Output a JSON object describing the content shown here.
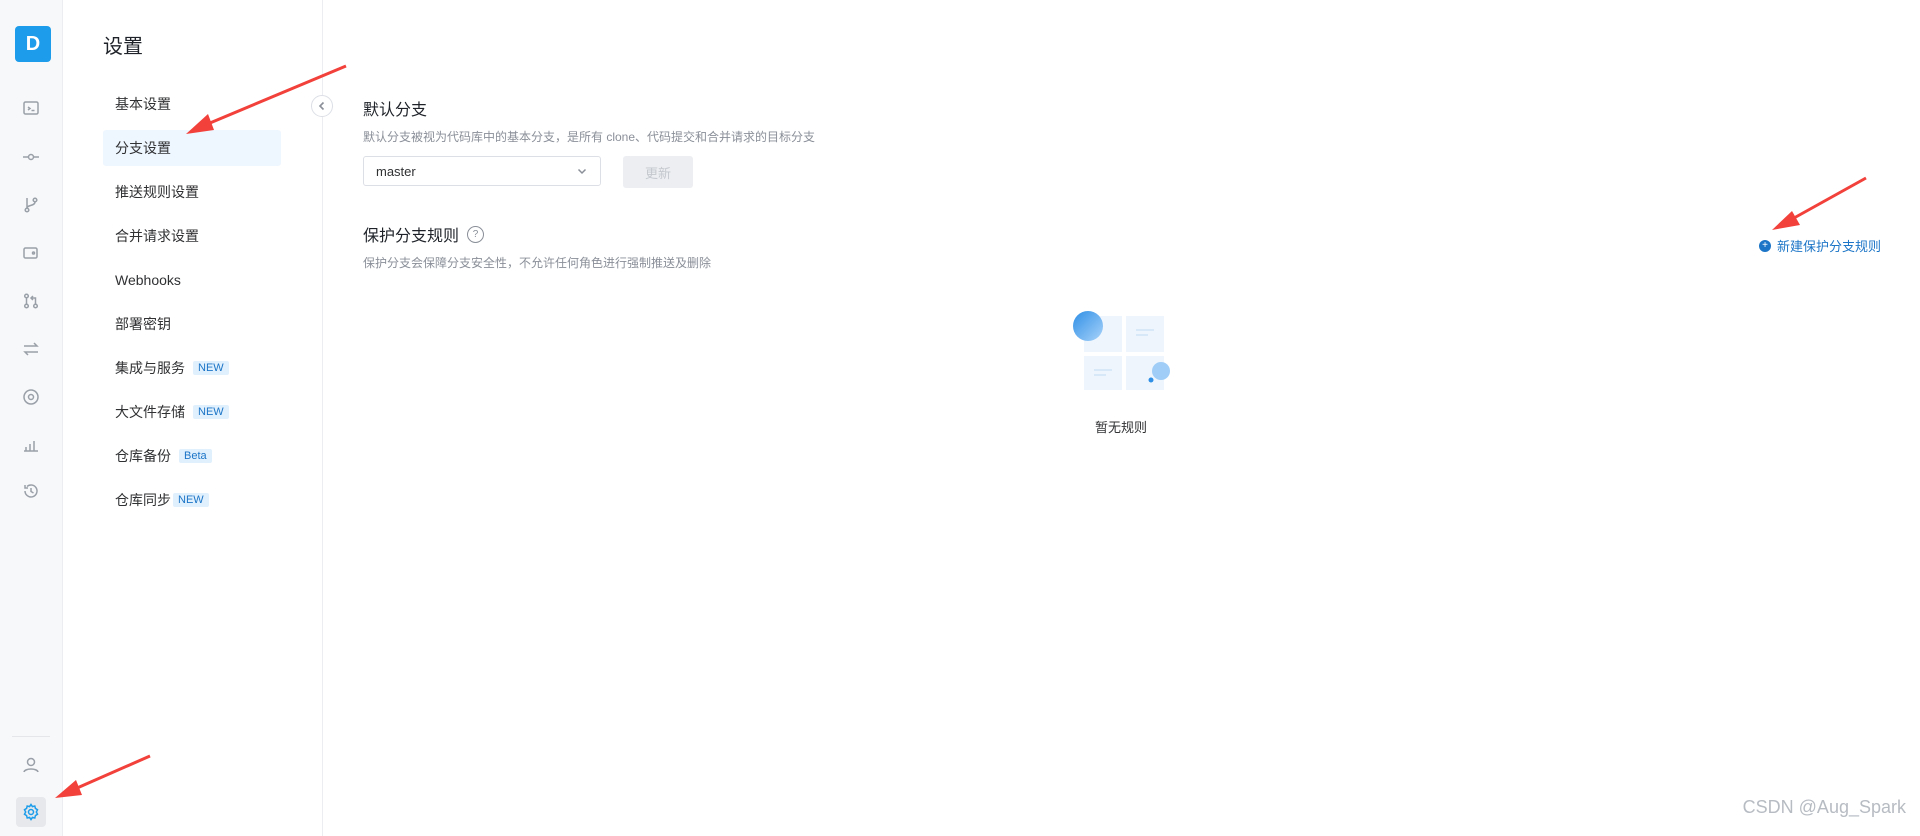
{
  "rail": {
    "logo_letter": "D",
    "icons": [
      "code-icon",
      "commit-icon",
      "branch-icon",
      "tag-icon",
      "merge-request-icon",
      "compare-icon",
      "eye-icon",
      "stats-icon",
      "history-icon",
      "user-icon",
      "gear-icon"
    ],
    "accent": "#1c9cea"
  },
  "page": {
    "title": "设置"
  },
  "subnav": {
    "items": [
      {
        "label": "基本设置"
      },
      {
        "label": "分支设置"
      },
      {
        "label": "推送规则设置"
      },
      {
        "label": "合并请求设置"
      },
      {
        "label": "Webhooks"
      },
      {
        "label": "部署密钥"
      },
      {
        "label": "集成与服务",
        "badge": "NEW"
      },
      {
        "label": "大文件存储",
        "badge": "NEW"
      },
      {
        "label": "仓库备份",
        "badge": "Beta"
      },
      {
        "label": "仓库同步",
        "badge": "NEW"
      }
    ],
    "active_index": 1
  },
  "default_branch": {
    "title": "默认分支",
    "description": "默认分支被视为代码库中的基本分支，是所有 clone、代码提交和合并请求的目标分支",
    "selected": "master",
    "update_label": "更新"
  },
  "protected": {
    "title": "保护分支规则",
    "help_glyph": "?",
    "description": "保护分支会保障分支安全性，不允许任何角色进行强制推送及删除",
    "new_rule_label": "新建保护分支规则",
    "plus_glyph": "+",
    "empty_text": "暂无规则"
  },
  "watermark": "CSDN @Aug_Spark",
  "colors": {
    "link": "#1c75c7",
    "active_bg": "#eef6ff",
    "arrow": "#f2403a"
  }
}
